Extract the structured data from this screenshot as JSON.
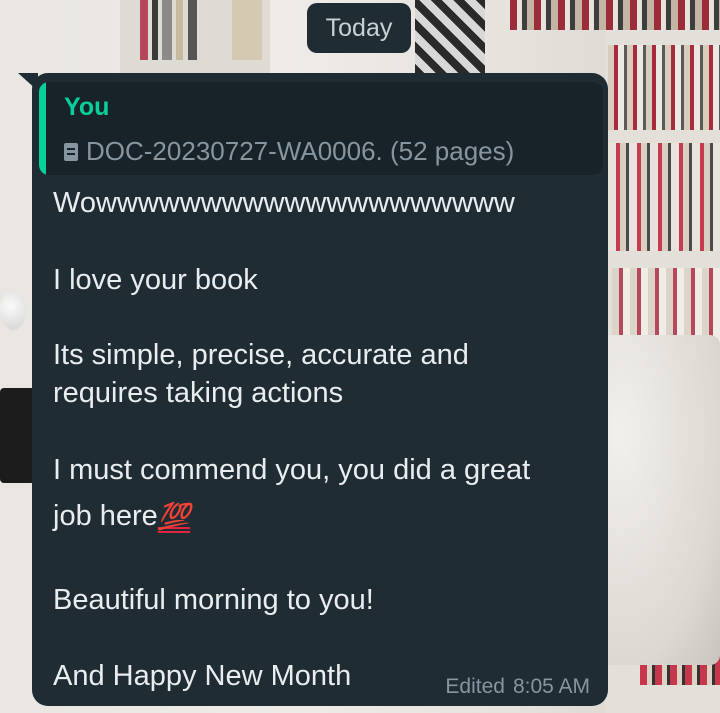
{
  "chat": {
    "date_chip": "Today",
    "message": {
      "reply": {
        "author": "You",
        "document": "DOC-20230727-WA0006. (52 pages)"
      },
      "lines": [
        "Wowwwwwwwwwwwwwwwwwwww",
        "I love your book",
        "Its simple, precise, accurate and",
        "requires taking actions",
        "I must commend you, you did a great",
        "job here",
        "Beautiful morning to you!",
        "And Happy New Month"
      ],
      "emoji": "💯",
      "edited_label": "Edited",
      "time": "8:05 AM"
    }
  },
  "colors": {
    "bubble": "#1f2c34",
    "reply_accent": "#06cf9c",
    "text": "#e9edef",
    "meta": "#8696a0"
  },
  "icons": [
    "document-icon",
    "hundred-points-emoji"
  ]
}
